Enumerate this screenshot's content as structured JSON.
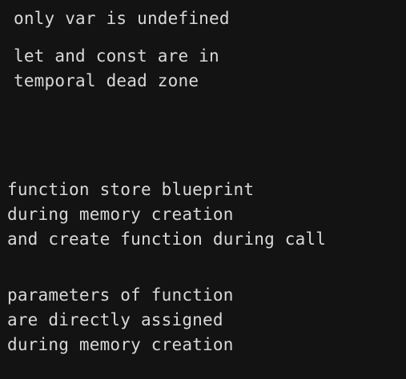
{
  "theme": {
    "background": "#131313",
    "text": "#d9d9d9"
  },
  "notes": [
    {
      "lines": [
        "only var is undefined"
      ]
    },
    {
      "lines": [
        "let and const are in",
        "temporal dead zone"
      ]
    },
    {
      "lines": [
        "function store blueprint",
        "during memory creation",
        "and create function during call"
      ]
    },
    {
      "lines": [
        "parameters of function",
        "are directly assigned",
        "during memory creation"
      ]
    }
  ]
}
